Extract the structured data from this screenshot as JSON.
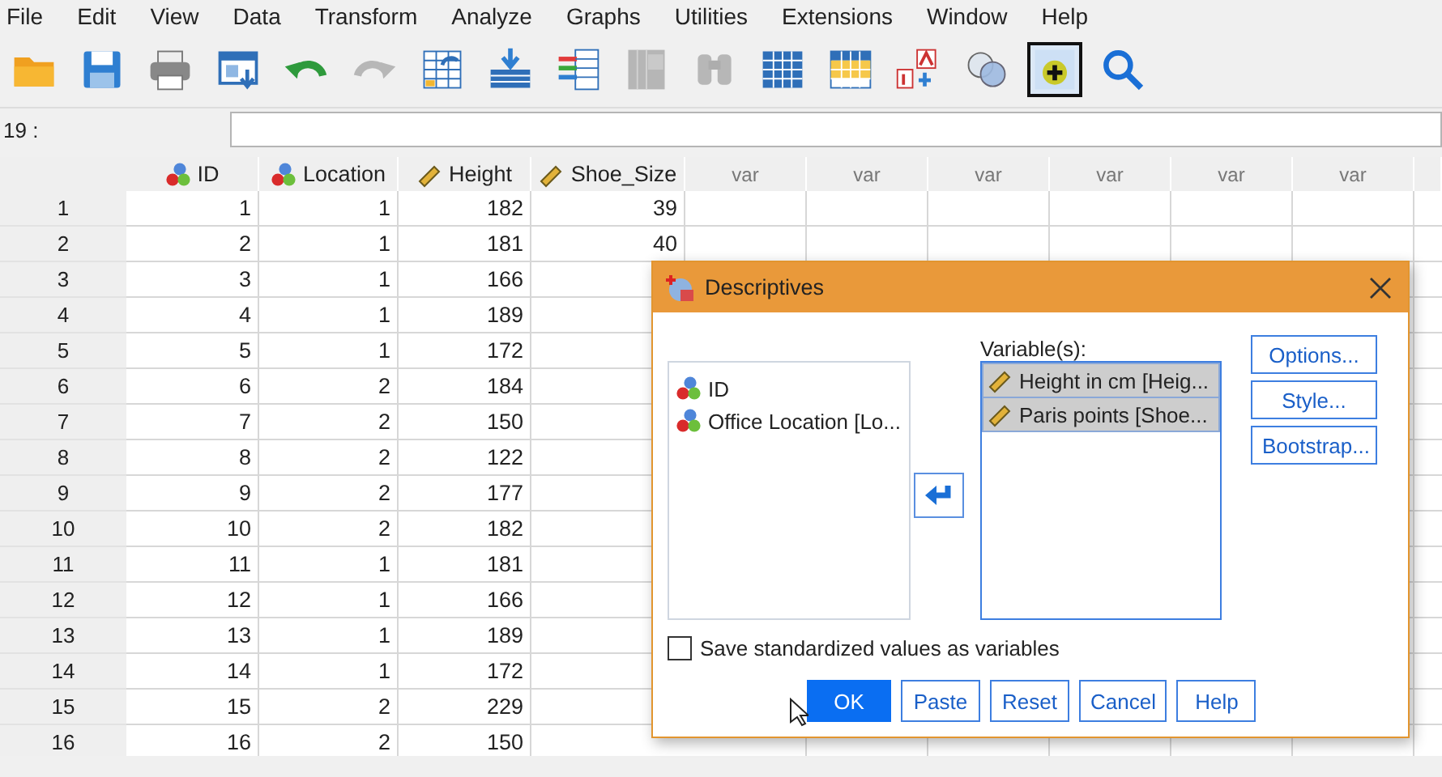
{
  "menu": [
    {
      "label": "File"
    },
    {
      "label": "Edit"
    },
    {
      "label": "View"
    },
    {
      "label": "Data"
    },
    {
      "label": "Transform"
    },
    {
      "label": "Analyze"
    },
    {
      "label": "Graphs"
    },
    {
      "label": "Utilities"
    },
    {
      "label": "Extensions"
    },
    {
      "label": "Window"
    },
    {
      "label": "Help"
    }
  ],
  "toolbar": [
    {
      "disabled": false,
      "pressed": false
    },
    {
      "disabled": false,
      "pressed": false
    },
    {
      "disabled": false,
      "pressed": false
    },
    {
      "disabled": false,
      "pressed": false
    },
    {
      "disabled": false,
      "pressed": false
    },
    {
      "disabled": true,
      "pressed": false
    },
    {
      "disabled": false,
      "pressed": false
    },
    {
      "disabled": false,
      "pressed": false
    },
    {
      "disabled": false,
      "pressed": false
    },
    {
      "disabled": true,
      "pressed": false
    },
    {
      "disabled": true,
      "pressed": false
    },
    {
      "disabled": false,
      "pressed": false
    },
    {
      "disabled": false,
      "pressed": false
    },
    {
      "disabled": false,
      "pressed": false
    },
    {
      "disabled": false,
      "pressed": false
    },
    {
      "disabled": false,
      "pressed": true
    },
    {
      "disabled": false,
      "pressed": false
    }
  ],
  "cell_editor": {
    "cell": "19 :"
  },
  "grid": {
    "columns": [
      {
        "name": "ID",
        "kind": "nominal"
      },
      {
        "name": "Location",
        "kind": "nominal"
      },
      {
        "name": "Height",
        "kind": "scale"
      },
      {
        "name": "Shoe_Size",
        "kind": "scale"
      },
      {
        "name": "var",
        "kind": "empty"
      },
      {
        "name": "var",
        "kind": "empty"
      },
      {
        "name": "var",
        "kind": "empty"
      },
      {
        "name": "var",
        "kind": "empty"
      },
      {
        "name": "var",
        "kind": "empty"
      },
      {
        "name": "var",
        "kind": "empty"
      }
    ],
    "rows": [
      {
        "case": "1",
        "values": [
          "1",
          "1",
          "182",
          "39"
        ]
      },
      {
        "case": "2",
        "values": [
          "2",
          "1",
          "181",
          "40"
        ]
      },
      {
        "case": "3",
        "values": [
          "3",
          "1",
          "166"
        ]
      },
      {
        "case": "4",
        "values": [
          "4",
          "1",
          "189"
        ]
      },
      {
        "case": "5",
        "values": [
          "5",
          "1",
          "172"
        ]
      },
      {
        "case": "6",
        "values": [
          "6",
          "2",
          "184"
        ]
      },
      {
        "case": "7",
        "values": [
          "7",
          "2",
          "150"
        ]
      },
      {
        "case": "8",
        "values": [
          "8",
          "2",
          "122"
        ]
      },
      {
        "case": "9",
        "values": [
          "9",
          "2",
          "177"
        ]
      },
      {
        "case": "10",
        "values": [
          "10",
          "2",
          "182"
        ]
      },
      {
        "case": "11",
        "values": [
          "11",
          "1",
          "181"
        ]
      },
      {
        "case": "12",
        "values": [
          "12",
          "1",
          "166"
        ]
      },
      {
        "case": "13",
        "values": [
          "13",
          "1",
          "189"
        ]
      },
      {
        "case": "14",
        "values": [
          "14",
          "1",
          "172"
        ]
      },
      {
        "case": "15",
        "values": [
          "15",
          "2",
          "229"
        ]
      },
      {
        "case": "16",
        "values": [
          "16",
          "2",
          "150"
        ]
      }
    ]
  },
  "dialog": {
    "title": "Descriptives",
    "source_list": [
      {
        "label": "ID",
        "kind": "nominal",
        "selected": false
      },
      {
        "label": "Office Location [Lo...",
        "kind": "nominal",
        "selected": false
      }
    ],
    "target_label": "Variable(s):",
    "target_list": [
      {
        "label": "Height in cm [Heig...",
        "kind": "scale",
        "selected": true
      },
      {
        "label": "Paris points [Shoe...",
        "kind": "scale",
        "selected": true
      }
    ],
    "side_buttons": [
      {
        "label": "Options..."
      },
      {
        "label": "Style..."
      },
      {
        "label": "Bootstrap..."
      }
    ],
    "checkbox": {
      "label": "Save standardized values as variables",
      "checked": false
    },
    "buttons": [
      {
        "label": "OK",
        "default": true
      },
      {
        "label": "Paste",
        "default": false
      },
      {
        "label": "Reset",
        "default": false
      },
      {
        "label": "Cancel",
        "default": false
      },
      {
        "label": "Help",
        "default": false
      }
    ]
  }
}
